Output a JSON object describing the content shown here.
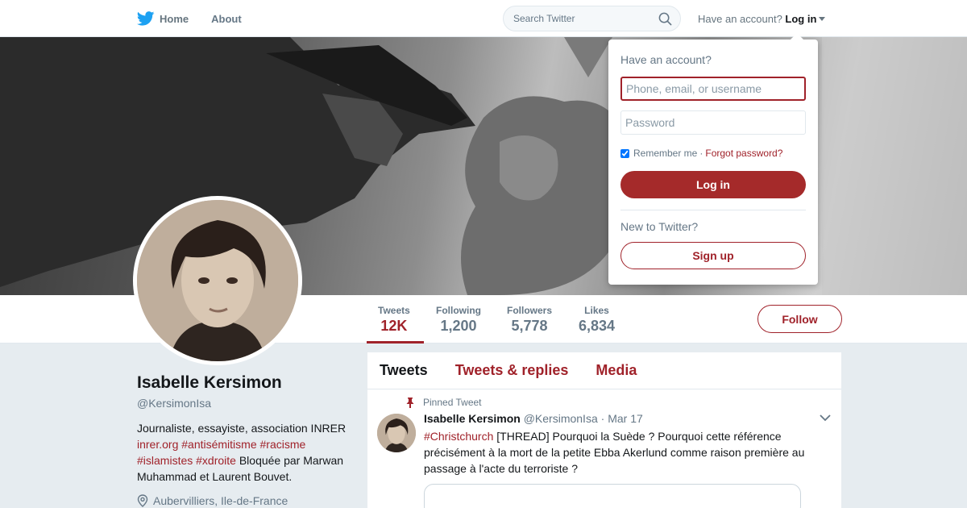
{
  "nav": {
    "home_label": "Home",
    "about_label": "About",
    "search_placeholder": "Search Twitter",
    "have_account_text": "Have an account?",
    "login_label": "Log in"
  },
  "profile": {
    "name": "Isabelle Kersimon",
    "handle": "@KersimonIsa",
    "bio_text_1": "Journaliste, essayiste, association INRER",
    "bio_link_1": "inrer.org",
    "bio_hashtag_1": "#antisémitisme",
    "bio_hashtag_2": "#racisme",
    "bio_hashtag_3": "#islamistes",
    "bio_hashtag_4": "#xdroite",
    "bio_text_2": "Bloquée par Marwan Muhammad et Laurent Bouvet.",
    "location": "Aubervilliers, Ile-de-France"
  },
  "stats": [
    {
      "label": "Tweets",
      "value": "12K"
    },
    {
      "label": "Following",
      "value": "1,200"
    },
    {
      "label": "Followers",
      "value": "5,778"
    },
    {
      "label": "Likes",
      "value": "6,834"
    }
  ],
  "follow_label": "Follow",
  "tabs": [
    {
      "label": "Tweets"
    },
    {
      "label": "Tweets & replies"
    },
    {
      "label": "Media"
    }
  ],
  "tweet": {
    "pinned_label": "Pinned Tweet",
    "name": "Isabelle Kersimon",
    "handle": "@KersimonIsa",
    "separator": "·",
    "date": "Mar 17",
    "hashtag": "#Christchurch",
    "text": "[THREAD] Pourquoi la Suède ? Pourquoi cette référence précisément à la mort de la petite Ebba Akerlund comme raison première au passage à l'acte du terroriste ?"
  },
  "login_dropdown": {
    "title": "Have an account?",
    "username_placeholder": "Phone, email, or username",
    "password_placeholder": "Password",
    "remember_label": "Remember me",
    "separator": "·",
    "forgot_label": "Forgot password?",
    "login_button": "Log in",
    "new_label": "New to Twitter?",
    "signup_button": "Sign up"
  },
  "colors": {
    "brand_link": "#a0222a",
    "twitter_blue": "#1da1f2",
    "login_button": "#a52a2a"
  },
  "icons": [
    "twitter-bird-icon",
    "search-icon",
    "caret-down-icon",
    "pin-icon",
    "location-icon",
    "chevron-down-icon"
  ]
}
